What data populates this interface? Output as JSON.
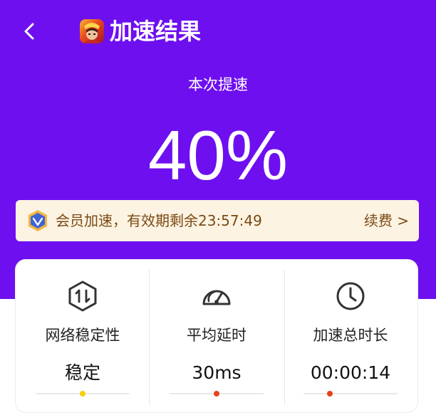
{
  "header": {
    "title": "加速结果",
    "back_icon": "chevron-left-icon",
    "app_icon": "game-app-icon"
  },
  "result": {
    "label": "本次提速",
    "value": "40%"
  },
  "vip": {
    "icon": "vip-shield-icon",
    "text": "会员加速，有效期剩余23:57:49",
    "renew_label": "续费 >"
  },
  "stats": [
    {
      "label": "网络稳定性",
      "value": "稳定",
      "icon": "signal-stability-icon",
      "indicator_level": 0.5,
      "indicator_color": "#f5d000"
    },
    {
      "label": "平均延时",
      "value": "30ms",
      "icon": "speedometer-icon",
      "indicator_level": 0.5,
      "indicator_color": "#e8421a"
    },
    {
      "label": "加速总时长",
      "value": "00:00:14",
      "icon": "clock-icon",
      "indicator_level": 0.28,
      "indicator_color": "#e8421a"
    }
  ],
  "colors": {
    "hero_bg": "#6e0ff0",
    "banner_bg": "#fdf3e2",
    "banner_text": "#7a4a15"
  }
}
